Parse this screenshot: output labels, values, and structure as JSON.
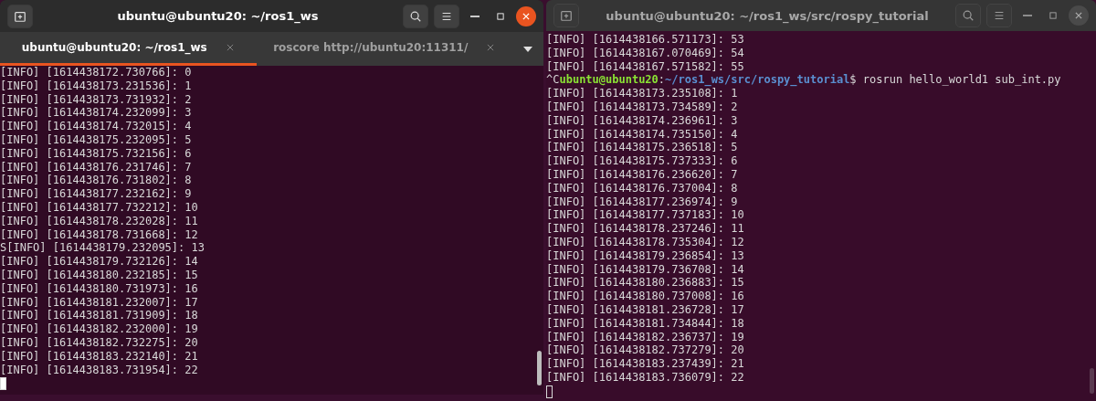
{
  "windows": [
    {
      "title": "ubuntu@ubuntu20: ~/ros1_ws",
      "focused": true,
      "tabs": [
        {
          "label": "ubuntu@ubuntu20: ~/ros1_ws",
          "selected": true
        },
        {
          "label": "roscore http://ubuntu20:11311/",
          "selected": false
        }
      ],
      "lines": [
        {
          "kind": "output",
          "text": "[INFO] [1614438172.730766]: 0"
        },
        {
          "kind": "output",
          "text": "[INFO] [1614438173.231536]: 1"
        },
        {
          "kind": "output",
          "text": "[INFO] [1614438173.731932]: 2"
        },
        {
          "kind": "output",
          "text": "[INFO] [1614438174.232099]: 3"
        },
        {
          "kind": "output",
          "text": "[INFO] [1614438174.732015]: 4"
        },
        {
          "kind": "output",
          "text": "[INFO] [1614438175.232095]: 5"
        },
        {
          "kind": "output",
          "text": "[INFO] [1614438175.732156]: 6"
        },
        {
          "kind": "output",
          "text": "[INFO] [1614438176.231746]: 7"
        },
        {
          "kind": "output",
          "text": "[INFO] [1614438176.731802]: 8"
        },
        {
          "kind": "output",
          "text": "[INFO] [1614438177.232162]: 9"
        },
        {
          "kind": "output",
          "text": "[INFO] [1614438177.732212]: 10"
        },
        {
          "kind": "output",
          "text": "[INFO] [1614438178.232028]: 11"
        },
        {
          "kind": "output",
          "text": "[INFO] [1614438178.731668]: 12"
        },
        {
          "kind": "output",
          "text": "S[INFO] [1614438179.232095]: 13"
        },
        {
          "kind": "output",
          "text": "[INFO] [1614438179.732126]: 14"
        },
        {
          "kind": "output",
          "text": "[INFO] [1614438180.232185]: 15"
        },
        {
          "kind": "output",
          "text": "[INFO] [1614438180.731973]: 16"
        },
        {
          "kind": "output",
          "text": "[INFO] [1614438181.232007]: 17"
        },
        {
          "kind": "output",
          "text": "[INFO] [1614438181.731909]: 18"
        },
        {
          "kind": "output",
          "text": "[INFO] [1614438182.232000]: 19"
        },
        {
          "kind": "output",
          "text": "[INFO] [1614438182.732275]: 20"
        },
        {
          "kind": "output",
          "text": "[INFO] [1614438183.232140]: 21"
        },
        {
          "kind": "output",
          "text": "[INFO] [1614438183.731954]: 22"
        }
      ]
    },
    {
      "title": "ubuntu@ubuntu20: ~/ros1_ws/src/rospy_tutorial",
      "focused": false,
      "lines": [
        {
          "kind": "output",
          "text": "[INFO] [1614438166.571173]: 53"
        },
        {
          "kind": "output",
          "text": "[INFO] [1614438167.070469]: 54"
        },
        {
          "kind": "output",
          "text": "[INFO] [1614438167.571582]: 55"
        },
        {
          "kind": "prompt",
          "interrupt": "^C",
          "user_host": "ubuntu@ubuntu20",
          "separator": ":",
          "path": "~/ros1_ws/src/rospy_tutorial",
          "command": "$ rosrun hello_world1 sub_int.py"
        },
        {
          "kind": "output",
          "text": "[INFO] [1614438173.235108]: 1"
        },
        {
          "kind": "output",
          "text": "[INFO] [1614438173.734589]: 2"
        },
        {
          "kind": "output",
          "text": "[INFO] [1614438174.236961]: 3"
        },
        {
          "kind": "output",
          "text": "[INFO] [1614438174.735150]: 4"
        },
        {
          "kind": "output",
          "text": "[INFO] [1614438175.236518]: 5"
        },
        {
          "kind": "output",
          "text": "[INFO] [1614438175.737333]: 6"
        },
        {
          "kind": "output",
          "text": "[INFO] [1614438176.236620]: 7"
        },
        {
          "kind": "output",
          "text": "[INFO] [1614438176.737004]: 8"
        },
        {
          "kind": "output",
          "text": "[INFO] [1614438177.236974]: 9"
        },
        {
          "kind": "output",
          "text": "[INFO] [1614438177.737183]: 10"
        },
        {
          "kind": "output",
          "text": "[INFO] [1614438178.237246]: 11"
        },
        {
          "kind": "output",
          "text": "[INFO] [1614438178.735304]: 12"
        },
        {
          "kind": "output",
          "text": "[INFO] [1614438179.236854]: 13"
        },
        {
          "kind": "output",
          "text": "[INFO] [1614438179.736708]: 14"
        },
        {
          "kind": "output",
          "text": "[INFO] [1614438180.236883]: 15"
        },
        {
          "kind": "output",
          "text": "[INFO] [1614438180.737008]: 16"
        },
        {
          "kind": "output",
          "text": "[INFO] [1614438181.236728]: 17"
        },
        {
          "kind": "output",
          "text": "[INFO] [1614438181.734844]: 18"
        },
        {
          "kind": "output",
          "text": "[INFO] [1614438182.236737]: 19"
        },
        {
          "kind": "output",
          "text": "[INFO] [1614438182.737279]: 20"
        },
        {
          "kind": "output",
          "text": "[INFO] [1614438183.237439]: 21"
        },
        {
          "kind": "output",
          "text": "[INFO] [1614438183.736079]: 22"
        }
      ]
    }
  ]
}
